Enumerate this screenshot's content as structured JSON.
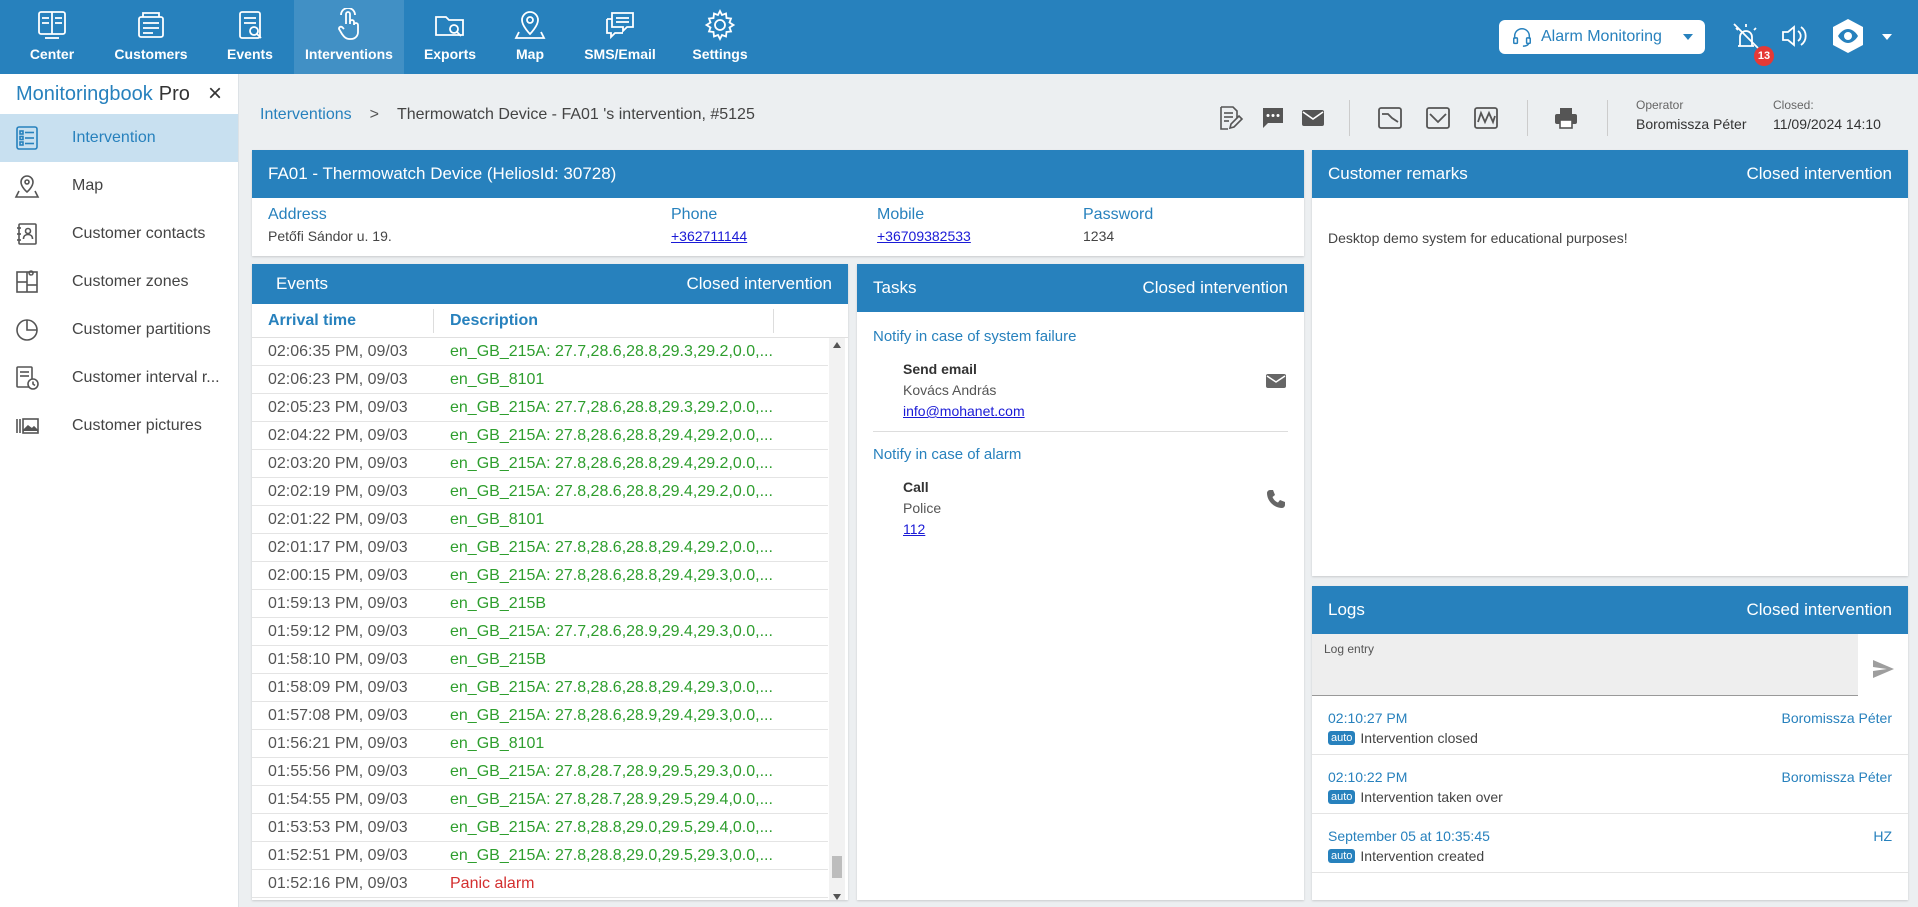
{
  "nav": {
    "items": [
      {
        "label": "Center",
        "icon": "center-icon"
      },
      {
        "label": "Customers",
        "icon": "customers-icon"
      },
      {
        "label": "Events",
        "icon": "events-icon"
      },
      {
        "label": "Interventions",
        "icon": "interventions-icon",
        "active": true
      },
      {
        "label": "Exports",
        "icon": "exports-icon"
      },
      {
        "label": "Map",
        "icon": "map-icon"
      },
      {
        "label": "SMS/Email",
        "icon": "sms-email-icon"
      },
      {
        "label": "Settings",
        "icon": "settings-icon"
      }
    ],
    "alarm_select": "Alarm Monitoring",
    "badge": "13"
  },
  "sidebar": {
    "brand_main": "Monitoringbook",
    "brand_sub": "Pro",
    "items": [
      {
        "label": "Intervention",
        "icon": "intervention-list-icon"
      },
      {
        "label": "Map",
        "icon": "map-pin-icon"
      },
      {
        "label": "Customer contacts",
        "icon": "contacts-icon"
      },
      {
        "label": "Customer zones",
        "icon": "zones-icon"
      },
      {
        "label": "Customer partitions",
        "icon": "pie-icon"
      },
      {
        "label": "Customer interval r...",
        "icon": "interval-icon"
      },
      {
        "label": "Customer pictures",
        "icon": "pictures-icon"
      }
    ]
  },
  "breadcrumb": {
    "link": "Interventions",
    "sep": ">",
    "current": "Thermowatch Device - FA01 's intervention, #5125"
  },
  "meta": {
    "operator_label": "Operator",
    "operator": "Boromissza Péter",
    "closed_label": "Closed:",
    "closed": "11/09/2024 14:10"
  },
  "device": {
    "title": "FA01 - Thermowatch Device (HeliosId: 30728)",
    "address_label": "Address",
    "address": "Petőfi Sándor u. 19.",
    "phone_label": "Phone",
    "phone": "+362711144",
    "mobile_label": "Mobile",
    "mobile": "+36709382533",
    "password_label": "Password",
    "password": "1234"
  },
  "events": {
    "title": "Events",
    "status": "Closed intervention",
    "col_time": "Arrival time",
    "col_desc": "Description",
    "rows": [
      {
        "time": "02:06:35 PM, 09/03",
        "desc": "en_GB_215A: 27.7,28.6,28.8,29.3,29.2,0.0,..."
      },
      {
        "time": "02:06:23 PM, 09/03",
        "desc": "en_GB_8101"
      },
      {
        "time": "02:05:23 PM, 09/03",
        "desc": "en_GB_215A: 27.7,28.6,28.8,29.3,29.2,0.0,..."
      },
      {
        "time": "02:04:22 PM, 09/03",
        "desc": "en_GB_215A: 27.8,28.6,28.8,29.4,29.2,0.0,..."
      },
      {
        "time": "02:03:20 PM, 09/03",
        "desc": "en_GB_215A: 27.8,28.6,28.8,29.4,29.2,0.0,..."
      },
      {
        "time": "02:02:19 PM, 09/03",
        "desc": "en_GB_215A: 27.8,28.6,28.8,29.4,29.2,0.0,..."
      },
      {
        "time": "02:01:22 PM, 09/03",
        "desc": "en_GB_8101"
      },
      {
        "time": "02:01:17 PM, 09/03",
        "desc": "en_GB_215A: 27.8,28.6,28.8,29.4,29.2,0.0,..."
      },
      {
        "time": "02:00:15 PM, 09/03",
        "desc": "en_GB_215A: 27.8,28.6,28.8,29.4,29.3,0.0,..."
      },
      {
        "time": "01:59:13 PM, 09/03",
        "desc": "en_GB_215B"
      },
      {
        "time": "01:59:12 PM, 09/03",
        "desc": "en_GB_215A: 27.7,28.6,28.9,29.4,29.3,0.0,..."
      },
      {
        "time": "01:58:10 PM, 09/03",
        "desc": "en_GB_215B"
      },
      {
        "time": "01:58:09 PM, 09/03",
        "desc": "en_GB_215A: 27.8,28.6,28.8,29.4,29.3,0.0,..."
      },
      {
        "time": "01:57:08 PM, 09/03",
        "desc": "en_GB_215A: 27.8,28.6,28.9,29.4,29.3,0.0,..."
      },
      {
        "time": "01:56:21 PM, 09/03",
        "desc": "en_GB_8101"
      },
      {
        "time": "01:55:56 PM, 09/03",
        "desc": "en_GB_215A: 27.8,28.7,28.9,29.5,29.3,0.0,..."
      },
      {
        "time": "01:54:55 PM, 09/03",
        "desc": "en_GB_215A: 27.8,28.7,28.9,29.5,29.4,0.0,..."
      },
      {
        "time": "01:53:53 PM, 09/03",
        "desc": "en_GB_215A: 27.8,28.8,29.0,29.5,29.4,0.0,..."
      },
      {
        "time": "01:52:51 PM, 09/03",
        "desc": "en_GB_215A: 27.8,28.8,29.0,29.5,29.3,0.0,..."
      },
      {
        "time": "01:52:16 PM, 09/03",
        "desc": "Panic alarm",
        "alarm": true
      }
    ]
  },
  "tasks": {
    "title": "Tasks",
    "status": "Closed intervention",
    "group1": "Notify in case of system failure",
    "task1_title": "Send email",
    "task1_name": "Kovács András",
    "task1_link": "info@mohanet.com",
    "group2": "Notify in case of alarm",
    "task2_title": "Call",
    "task2_name": "Police",
    "task2_link": "112"
  },
  "remarks": {
    "title": "Customer remarks",
    "status": "Closed intervention",
    "text": "Desktop demo system for educational purposes!"
  },
  "logs": {
    "title": "Logs",
    "status": "Closed intervention",
    "input_label": "Log entry",
    "entries": [
      {
        "time": "02:10:27 PM",
        "user": "Boromissza Péter",
        "tag": "auto",
        "text": "Intervention closed"
      },
      {
        "time": "02:10:22 PM",
        "user": "Boromissza Péter",
        "tag": "auto",
        "text": "Intervention taken over"
      },
      {
        "time": "September 05 at 10:35:45",
        "user": "HZ",
        "tag": "auto",
        "text": "Intervention created"
      }
    ]
  },
  "colors": {
    "primary": "#2781bd",
    "event_text": "#2e9e2e",
    "alarm_text": "#d32f2f",
    "link": "#1a1ad6"
  }
}
